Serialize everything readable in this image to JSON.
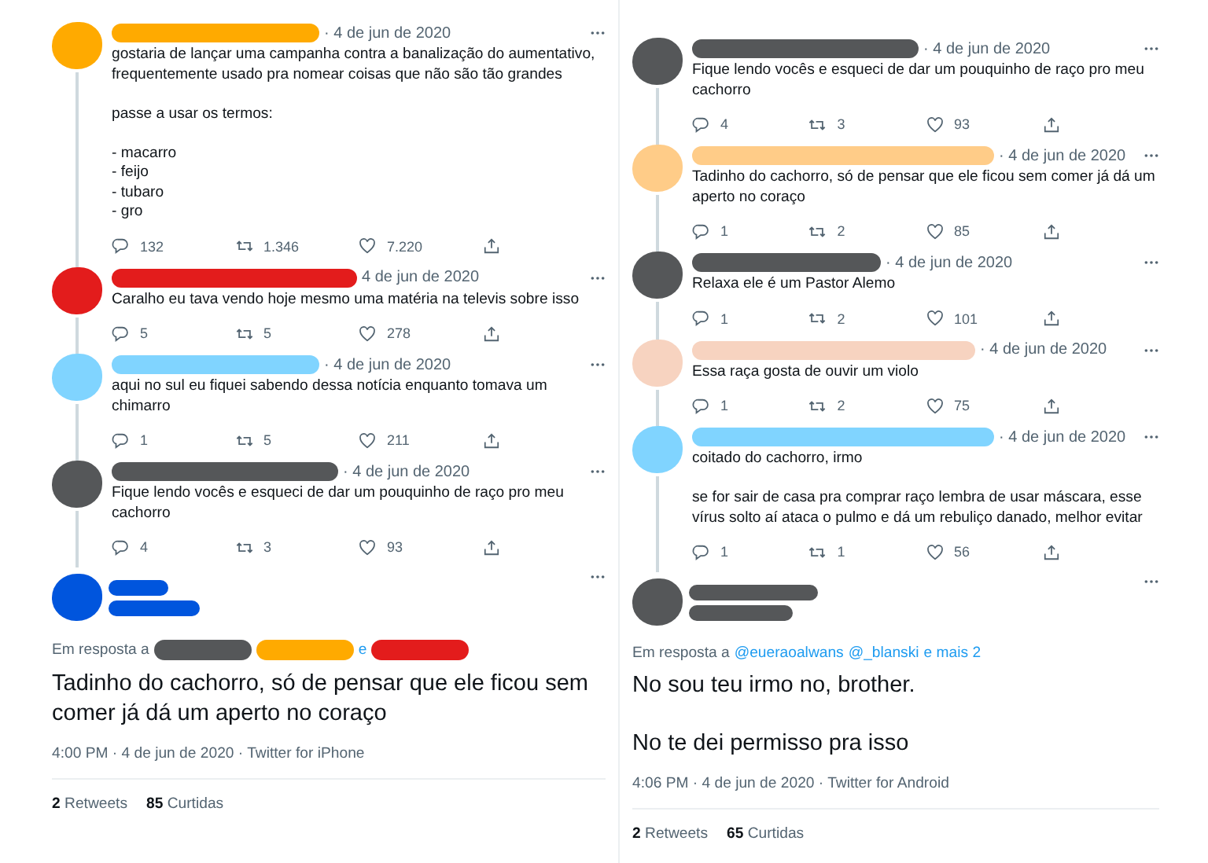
{
  "columns": [
    {
      "replies": [
        {
          "color": "#ffaa00",
          "date": "· 4 de jun de 2020",
          "text": "gostaria de lançar uma campanha contra a banalização do aumentativo, frequentemente usado pra nomear coisas que não são tão grandes\n\npasse a usar os termos:\n\n- macarro\n- feijo\n- tubaro\n- gro",
          "replies": "132",
          "retweets": "1.346",
          "likes": "7.220"
        },
        {
          "color": "#e31c1c",
          "date": "4 de jun de 2020",
          "text": "Caralho eu tava vendo hoje mesmo uma matéria na televis sobre isso",
          "replies": "5",
          "retweets": "5",
          "likes": "278"
        },
        {
          "color": "#80d4ff",
          "date": "· 4 de jun de 2020",
          "text": "aqui no sul eu fiquei sabendo dessa notícia enquanto tomava um chimarro",
          "replies": "1",
          "retweets": "5",
          "likes": "211"
        },
        {
          "color": "#555759",
          "date": "· 4 de jun de 2020",
          "text": "Fique lendo vocês e esqueci de dar um pouquinho de raço pro meu cachorro",
          "replies": "4",
          "retweets": "3",
          "likes": "93"
        }
      ],
      "main": {
        "color": "#0055dd",
        "reply_label": "Em resposta a",
        "reply_to": [
          {
            "kind": "redacted",
            "color": "#555759"
          },
          {
            "kind": "redacted",
            "color": "#ffaa00"
          },
          {
            "kind": "link",
            "text": "e"
          },
          {
            "kind": "redacted",
            "color": "#e31c1c"
          }
        ],
        "paragraphs": [
          "Tadinho do cachorro, só de pensar que ele ficou sem comer já dá um aperto no coraço"
        ],
        "meta": "4:00 PM · 4 de jun de 2020 · Twitter for iPhone",
        "retweets": "**2** Retweets",
        "likes": "**85** Curtidas"
      }
    },
    {
      "replies": [
        {
          "color": "#555759",
          "date": "· 4 de jun de 2020",
          "text": "Fique lendo vocês e esqueci de dar um pouquinho de raço pro meu cachorro",
          "replies": "4",
          "retweets": "3",
          "likes": "93"
        },
        {
          "color": "#ffcc88",
          "date": "· 4 de jun de 2020",
          "text": "Tadinho do cachorro, só de pensar que ele ficou sem comer já dá um aperto no coraço",
          "replies": "1",
          "retweets": "2",
          "likes": "85"
        },
        {
          "color": "#555759",
          "date": "· 4 de jun de 2020",
          "text": "Relaxa ele é um Pastor Alemo",
          "replies": "1",
          "retweets": "2",
          "likes": "101"
        },
        {
          "color": "#f7d3c0",
          "date": "· 4 de jun de 2020",
          "text": "Essa raça gosta de ouvir um violo",
          "replies": "1",
          "retweets": "2",
          "likes": "75"
        },
        {
          "color": "#80d4ff",
          "date": "· 4 de jun de 2020",
          "text": "coitado do cachorro, irmo\n\nse for sair de casa pra comprar raço lembra de usar máscara, esse vírus solto aí ataca o pulmo e dá um rebuliço danado, melhor evitar",
          "replies": "1",
          "retweets": "1",
          "likes": "56"
        }
      ],
      "main": {
        "color": "#555759",
        "reply_label": "Em resposta a",
        "reply_to": [
          {
            "kind": "link",
            "text": "@eueraoalwans"
          },
          {
            "kind": "link",
            "text": "@_blanski"
          },
          {
            "kind": "link",
            "text": "e mais 2"
          }
        ],
        "paragraphs": [
          "No sou teu irmo no, brother.",
          "No te dei permisso pra isso"
        ],
        "meta": "4:06 PM · 4 de jun de 2020 · Twitter for Android",
        "retweets": "**2** Retweets",
        "likes": "**65** Curtidas"
      }
    }
  ]
}
